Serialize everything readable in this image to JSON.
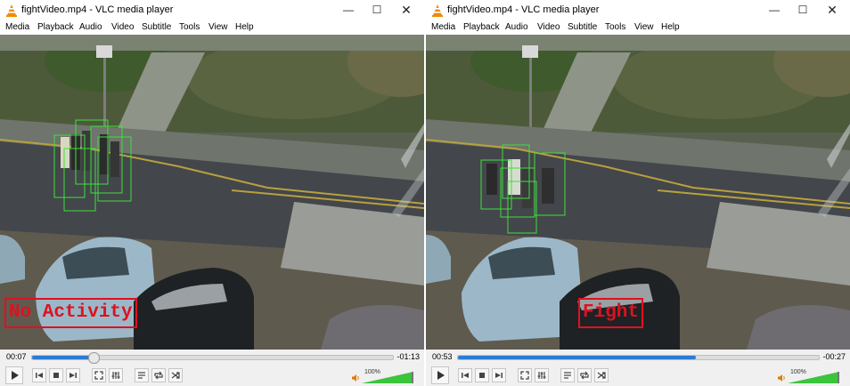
{
  "windows": [
    {
      "id": "left",
      "title": "fightVideo.mp4 - VLC media player",
      "menu": [
        "Media",
        "Playback",
        "Audio",
        "Video",
        "Subtitle",
        "Tools",
        "View",
        "Help"
      ],
      "overlay_label": "No Activity",
      "time_elapsed": "00:07",
      "time_remaining": "-01:13",
      "progress": 0.17,
      "volume_label": "100%",
      "volume": 1.0
    },
    {
      "id": "right",
      "title": "fightVideo.mp4 - VLC media player",
      "menu": [
        "Media",
        "Playback",
        "Audio",
        "Video",
        "Subtitle",
        "Tools",
        "View",
        "Help"
      ],
      "overlay_label": "Fight",
      "time_elapsed": "00:53",
      "time_remaining": "-00:27",
      "progress": 0.66,
      "volume_label": "100%",
      "volume": 1.0
    }
  ],
  "colors": {
    "seek_fill": "#2b7cd3",
    "detection_box": "#3ee03e",
    "overlay_text": "#e01020",
    "volume_fill": "#3cc43c",
    "vlc_orange": "#f08c00"
  },
  "icons": {
    "app": "vlc-cone-icon",
    "minimize": "minimize-icon",
    "maximize": "maximize-icon",
    "close": "close-icon",
    "controls": [
      "play-icon",
      "previous-icon",
      "stop-icon",
      "next-icon",
      "fullscreen-icon",
      "extended-settings-icon",
      "playlist-icon",
      "loop-icon",
      "shuffle-icon",
      "speaker-icon"
    ]
  }
}
